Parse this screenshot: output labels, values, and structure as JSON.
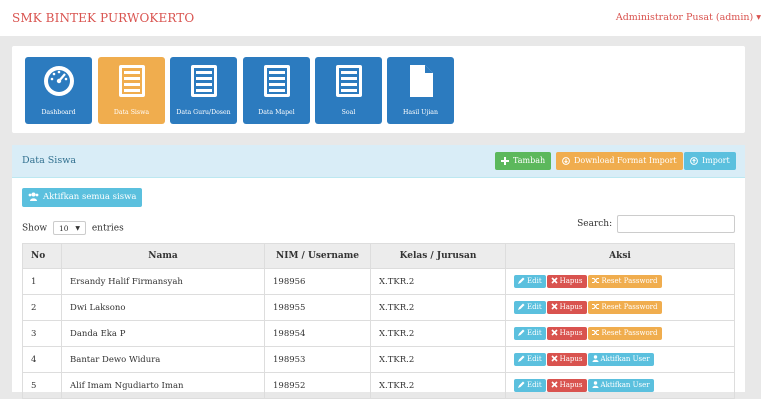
{
  "header": {
    "brand": "SMK BINTEK PURWOKERTO",
    "user": "Administrator Pusat (admin)",
    "user_caret": "▾"
  },
  "menu": {
    "tiles": [
      {
        "label": "Dashboard",
        "icon": "dashboard-icon",
        "active": false
      },
      {
        "label": "Data Siswa",
        "icon": "list-icon",
        "active": true
      },
      {
        "label": "Data Guru/Dosen",
        "icon": "list-icon",
        "active": false
      },
      {
        "label": "Data Mapel",
        "icon": "list-icon",
        "active": false
      },
      {
        "label": "Soal",
        "icon": "list-icon",
        "active": false
      },
      {
        "label": "Hasil Ujian",
        "icon": "file-icon",
        "active": false
      }
    ]
  },
  "panel": {
    "title": "Data Siswa",
    "tambah_label": "Tambah",
    "download_label": "Download Format Import",
    "import_label": "Import",
    "aktifkan_semua_label": "Aktifkan semua siswa"
  },
  "table_controls": {
    "show_label": "Show",
    "length_value": "10",
    "entries_label": "entries",
    "search_label": "Search:",
    "search_value": ""
  },
  "table": {
    "columns": [
      "No",
      "Nama",
      "NIM / Username",
      "Kelas / Jurusan",
      "Aksi"
    ],
    "rows": [
      {
        "no": "1",
        "nama": "Ersandy Halif Firmansyah",
        "nim": "198956",
        "kelas": "X.TKR.2",
        "third_action": "Reset Password"
      },
      {
        "no": "2",
        "nama": "Dwi Laksono",
        "nim": "198955",
        "kelas": "X.TKR.2",
        "third_action": "Reset Password"
      },
      {
        "no": "3",
        "nama": "Danda Eka P",
        "nim": "198954",
        "kelas": "X.TKR.2",
        "third_action": "Reset Password"
      },
      {
        "no": "4",
        "nama": "Bantar Dewo Widura",
        "nim": "198953",
        "kelas": "X.TKR.2",
        "third_action": "Aktifkan User"
      },
      {
        "no": "5",
        "nama": "Alif Imam Ngudiarto Iman",
        "nim": "198952",
        "kelas": "X.TKR.2",
        "third_action": "Aktifkan User"
      }
    ],
    "edit_label": "Edit",
    "hapus_label": "Hapus"
  },
  "colors": {
    "brand": "#d9534f",
    "tile": "#2c7bbf",
    "tile_active": "#f0ad4e",
    "panel_heading": "#d9edf7",
    "success": "#5cb85c",
    "warning": "#f0ad4e",
    "info": "#5bc0de",
    "danger": "#d9534f"
  }
}
